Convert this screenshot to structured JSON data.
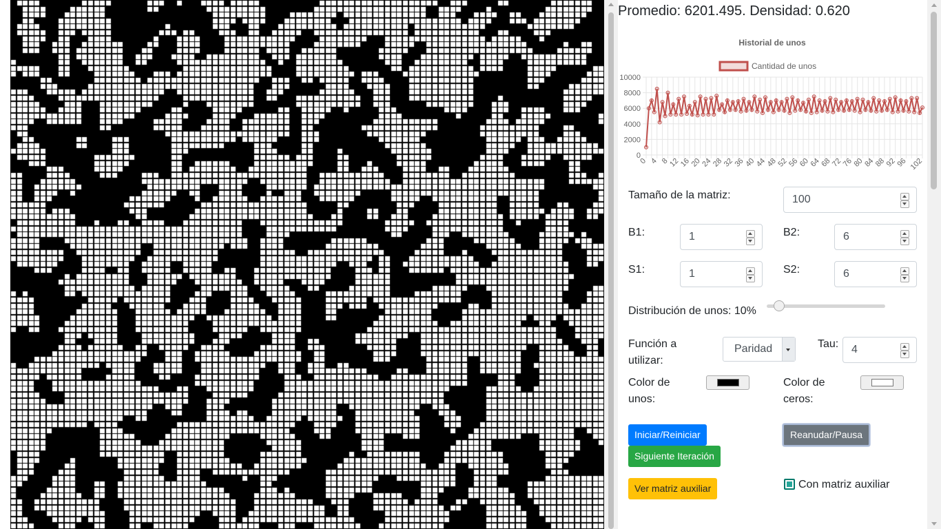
{
  "stats": {
    "text": "Promedio: 6201.495. Densidad: 0.620"
  },
  "grid": {
    "ones_color": "#000000",
    "zeros_color": "#ffffff"
  },
  "chart_data": {
    "type": "line",
    "title": "Historial de unos",
    "series": [
      {
        "name": "Cantidad de unos",
        "color": "#c0504d",
        "values": [
          1000,
          6000,
          7000,
          5500,
          8500,
          4200,
          6800,
          5000,
          8000,
          5200,
          6500,
          5200,
          7200,
          5200,
          7500,
          5300,
          6300,
          5200,
          6800,
          5100,
          7500,
          5200,
          7200,
          5200,
          7300,
          5200,
          7600,
          5800,
          6500,
          5500,
          7000,
          5800,
          6800,
          5800,
          6900,
          5600,
          7200,
          5700,
          6800,
          5800,
          7500,
          5600,
          7100,
          5400,
          7400,
          5800,
          6800,
          5500,
          7000,
          5800,
          6800,
          5700,
          7200,
          5400,
          7400,
          5700,
          7000,
          5800,
          6700,
          5600,
          7100,
          5400,
          7500,
          5500,
          7000,
          5700,
          6900,
          5600,
          7300,
          5500,
          7100,
          5800,
          6800,
          5700,
          7000,
          5800,
          6900,
          5700,
          7200,
          5500,
          7100,
          5800,
          6800,
          5700,
          7300,
          5600,
          7000,
          5700,
          6900,
          5800,
          7200,
          5500,
          7400,
          5600,
          7000,
          5700,
          6900,
          5600,
          7300,
          5500,
          7300,
          5400,
          6100
        ]
      }
    ],
    "ylim": [
      0,
      10000
    ],
    "yticks": [
      "0",
      "2000",
      "4000",
      "6000",
      "8000",
      "10000"
    ],
    "xticks": [
      "0",
      "4",
      "8",
      "12",
      "16",
      "20",
      "24",
      "28",
      "32",
      "36",
      "40",
      "44",
      "48",
      "52",
      "56",
      "60",
      "64",
      "68",
      "72",
      "76",
      "80",
      "84",
      "88",
      "92",
      "96",
      "102"
    ],
    "grid": true,
    "legend_position": "top"
  },
  "controls": {
    "matrix_size_label": "Tamaño de la matriz:",
    "matrix_size": "100",
    "b1_label": "B1:",
    "b1": "1",
    "b2_label": "B2:",
    "b2": "6",
    "s1_label": "S1:",
    "s1": "1",
    "s2_label": "S2:",
    "s2": "6",
    "distribution_label": "Distribución de unos: 10%",
    "distribution_value": 10,
    "function_label_1": "Función a",
    "function_label_2": "utilizar:",
    "function_value": "Paridad",
    "tau_label": "Tau:",
    "tau": "4",
    "ones_color_label_1": "Color de",
    "ones_color_label_2": "unos:",
    "zeros_color_label_1": "Color de",
    "zeros_color_label_2": "ceros:"
  },
  "buttons": {
    "start": "Iniciar/Reiniciar",
    "pause": "Reanudar/Pausa",
    "next": "Siguiente Iteración",
    "aux": "Ver matriz auxiliar"
  },
  "aux_checkbox": {
    "label": "Con matriz auxiliar",
    "checked": true
  },
  "colors": {
    "primary": "#007bff",
    "secondary": "#6c757d",
    "success": "#28a745",
    "warning": "#ffc107",
    "check": "#26a69a"
  }
}
